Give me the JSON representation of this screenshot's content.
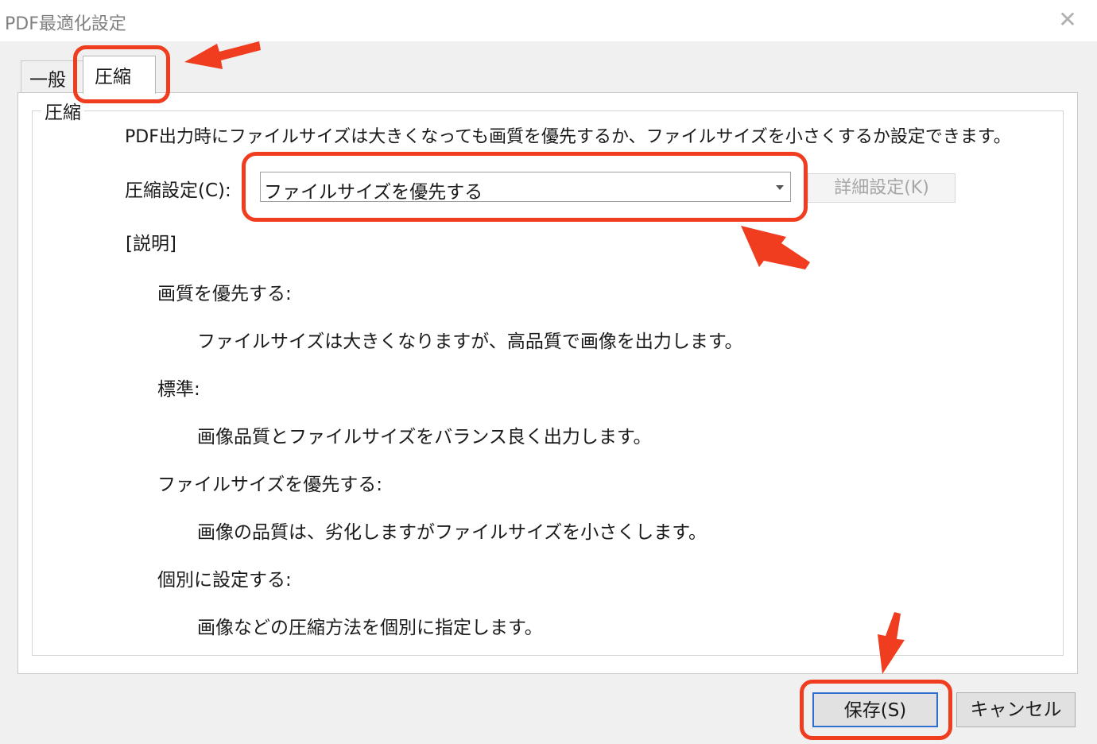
{
  "window": {
    "title": "PDF最適化設定"
  },
  "tabs": [
    {
      "label": "一般",
      "selected": false
    },
    {
      "label": "圧縮",
      "selected": true
    }
  ],
  "group": {
    "title": "圧縮",
    "intro": "PDF出力時にファイルサイズは大きくなっても画質を優先するか、ファイルサイズを小さくするか設定できます。",
    "setting_label": "圧縮設定(C):",
    "setting_value": "ファイルサイズを優先する",
    "detail_button": "詳細設定(K)",
    "description_heading": "[説明]",
    "descriptions": [
      {
        "title": "画質を優先する:",
        "text": "ファイルサイズは大きくなりますが、高品質で画像を出力します。"
      },
      {
        "title": "標準:",
        "text": "画像品質とファイルサイズをバランス良く出力します。"
      },
      {
        "title": "ファイルサイズを優先する:",
        "text": "画像の品質は、劣化しますがファイルサイズを小さくします。"
      },
      {
        "title": "個別に設定する:",
        "text": "画像などの圧縮方法を個別に指定します。"
      }
    ]
  },
  "buttons": {
    "save": "保存(S)",
    "cancel": "キャンセル"
  },
  "colors": {
    "annotation": "#f03c1f",
    "focus_border": "#2f6fd0",
    "disabled_text": "#a6a6a6"
  },
  "icons": {
    "close": "close-icon",
    "dropdown": "chevron-down-icon"
  }
}
